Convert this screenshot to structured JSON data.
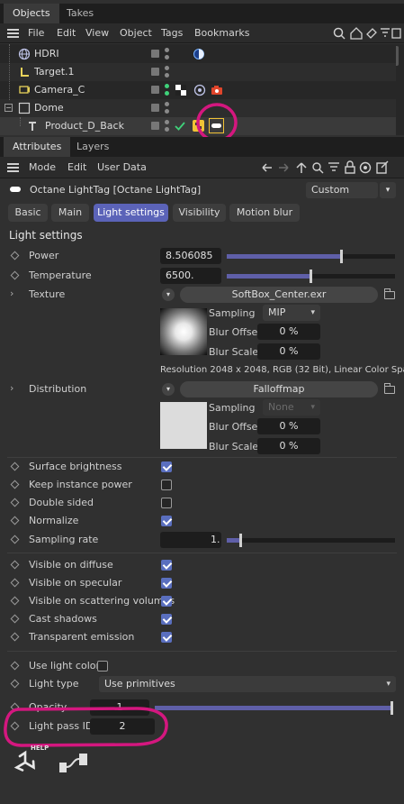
{
  "top_tabs": {
    "objects": "Objects",
    "takes": "Takes"
  },
  "menu": {
    "file": "File",
    "edit": "Edit",
    "view": "View",
    "object": "Object",
    "tags": "Tags",
    "bookmarks": "Bookmarks"
  },
  "objects": [
    {
      "name": "HDRI"
    },
    {
      "name": "Target.1"
    },
    {
      "name": "Camera_C"
    },
    {
      "name": "Dome"
    },
    {
      "name": "Product_D_Back"
    }
  ],
  "attr_tabs": {
    "attributes": "Attributes",
    "layers": "Layers"
  },
  "attr_menu": {
    "mode": "Mode",
    "edit": "Edit",
    "user_data": "User Data"
  },
  "tag_title": "Octane LightTag [Octane LightTag]",
  "preset": "Custom",
  "sub_tabs": {
    "basic": "Basic",
    "main": "Main",
    "light_settings": "Light settings",
    "visibility": "Visibility",
    "motion_blur": "Motion blur"
  },
  "section_title": "Light settings",
  "power": {
    "label": "Power",
    "value": "8.506085",
    "fraction": 0.69
  },
  "temperature": {
    "label": "Temperature",
    "value": "6500.",
    "fraction": 0.51
  },
  "texture": {
    "label": "Texture",
    "file": "SoftBox_Center.exr",
    "sampling_label": "Sampling",
    "sampling_value": "MIP",
    "blur_offset_label": "Blur Offset",
    "blur_offset_value": "0 %",
    "blur_scale_label": "Blur Scale",
    "blur_scale_value": "0 %",
    "resolution": "Resolution 2048 x 2048, RGB (32 Bit), Linear Color Spac"
  },
  "distribution": {
    "label": "Distribution",
    "name": "Falloffmap",
    "sampling_label": "Sampling",
    "sampling_value": "None",
    "blur_offset_label": "Blur Offset",
    "blur_offset_value": "0 %",
    "blur_scale_label": "Blur Scale",
    "blur_scale_value": "0 %"
  },
  "checks1": [
    {
      "label": "Surface brightness",
      "checked": true
    },
    {
      "label": "Keep instance power",
      "checked": false
    },
    {
      "label": "Double sided",
      "checked": false
    },
    {
      "label": "Normalize",
      "checked": true
    }
  ],
  "sampling_rate": {
    "label": "Sampling rate",
    "value": "1.",
    "fraction": 0.09
  },
  "checks2": [
    {
      "label": "Visible on diffuse",
      "checked": true
    },
    {
      "label": "Visible on specular",
      "checked": true
    },
    {
      "label": "Visible on scattering volumes",
      "checked": true
    },
    {
      "label": "Cast shadows",
      "checked": true
    },
    {
      "label": "Transparent emission",
      "checked": true
    }
  ],
  "use_light_color": {
    "label": "Use light color",
    "checked": false
  },
  "light_type": {
    "label": "Light type",
    "value": "Use primitives"
  },
  "opacity": {
    "label": "Opacity",
    "value": "1",
    "fraction": 1.0
  },
  "light_pass_id": {
    "label": "Light pass ID",
    "value": "2"
  },
  "help_label": "HELP",
  "colors": {
    "accent": "#5b63b8",
    "highlight": "#d4177f",
    "green": "#3fd27a"
  }
}
